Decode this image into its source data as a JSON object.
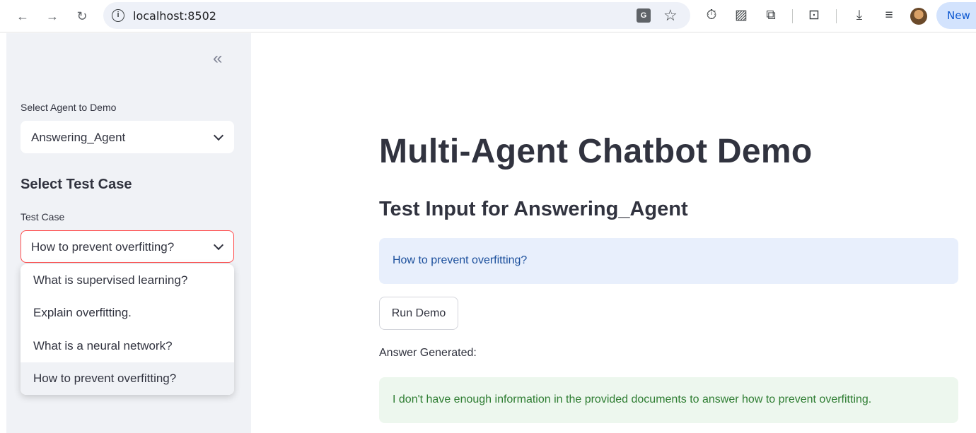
{
  "browser": {
    "url": "localhost:8502",
    "new_label": "New"
  },
  "sidebar": {
    "agent_label": "Select Agent to Demo",
    "agent_value": "Answering_Agent",
    "test_case_heading": "Select Test Case",
    "test_case_label": "Test Case",
    "test_case_value": "How to prevent overfitting?",
    "options": [
      "What is supervised learning?",
      "Explain overfitting.",
      "What is a neural network?",
      "How to prevent overfitting?"
    ],
    "selected_option_index": 3
  },
  "main": {
    "title": "Multi-Agent Chatbot Demo",
    "subtitle": "Test Input for Answering_Agent",
    "input_text": "How to prevent overfitting?",
    "run_button": "Run Demo",
    "answer_label": "Answer Generated:",
    "answer_text": "I don't have enough information in the provided documents to answer how to prevent overfitting."
  },
  "colors": {
    "accent": "#ff4b4b",
    "info_bg": "#e8effc",
    "info_text": "#1b4f9c",
    "success_bg": "#edf7ee",
    "success_text": "#2e7d32",
    "sidebar_bg": "#f0f2f6"
  }
}
